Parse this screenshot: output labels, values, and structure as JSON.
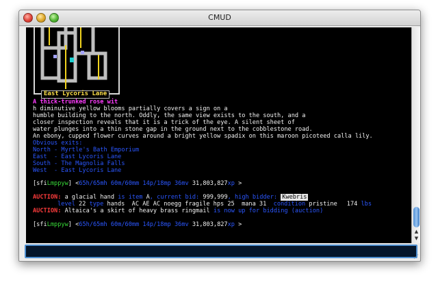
{
  "window": {
    "title": "CMUD"
  },
  "map": {
    "location_label": "East Lycoris Lane"
  },
  "room": {
    "name": "A thick-trunked rose wit",
    "description": [
      "h diminutive yellow blooms partially covers a sign on a",
      "humble building to the north. Oddly, the same view exists to the south, and a",
      "closer inspection reveals that it is a trick of the eye. A silent sheet of",
      "water plunges into a thin stone gap in the ground next to the cobblestone road.",
      "An ebony, cupped flower curves around a bright yellow spadix on this maroon picoteed calla lily."
    ],
    "exits": [
      "Obvious exits:",
      "North - Myrtle's Bath Emporium",
      "East  - East Lycoris Lane",
      "South - The Magnolia Falls",
      "West  - East Lycoris Lane"
    ]
  },
  "prompt1": {
    "open": "[sfi",
    "mid": "Lmppyw",
    "close": "] <",
    "blue": "65h/65mh 60m/60mm 14p/18mp 36mv ",
    "exp": "31,803,827",
    "tail": "xp ",
    "end": ">"
  },
  "auction1": {
    "tag": "AUCTION:",
    "line1": " a glacial hand ",
    "blue1": "is item ",
    "item_code": "A",
    "blue2": ", current bid: ",
    "bid": "999,999",
    "blue3": ", high bidder: ",
    "bidder": "Kwebris",
    "line2_blue1": "level ",
    "level": "22",
    "line2_blue2": " type ",
    "type": "hands",
    "stats": "  AC AE AC noegg fragile hps 25  mana 31 ",
    "line2_blue3": " condition ",
    "condition": "pristine",
    "weight": "174",
    "line2_blue4": " lbs"
  },
  "auction2": {
    "tag": "AUCTION:",
    "text": " Altaica's a skirt of heavy brass ringmail ",
    "blue": "is now up for bidding (auction)"
  },
  "prompt2": {
    "open": "[sfi",
    "mid": "Lmppyw",
    "close": "] <",
    "blue": "65h/65mh 60m/60mm 14p/18mp 36mv ",
    "exp": "31,803,827",
    "tail": "xp ",
    "end": ">"
  },
  "input": {
    "value": ""
  }
}
